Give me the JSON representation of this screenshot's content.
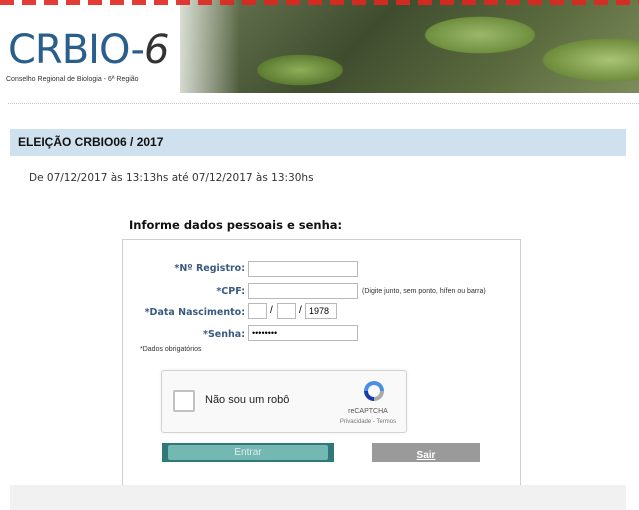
{
  "header": {
    "logo_main": "CRBIO-",
    "logo_number": "6",
    "logo_subtitle": "Conselho Regional de Biologia - 6ª Região"
  },
  "page": {
    "title": "ELEIÇÃO CRBIO06 / 2017",
    "period": "De 07/12/2017 às 13:13hs  até  07/12/2017 às 13:30hs"
  },
  "form": {
    "heading": "Informe dados pessoais e senha:",
    "registro_label": "*Nº Registro:",
    "registro_value": "",
    "cpf_label": "*CPF:",
    "cpf_value": "",
    "cpf_hint": "(Digite junto, sem ponto, hífen ou barra)",
    "nascimento_label": "*Data Nascimento:",
    "dia_value": "",
    "mes_value": "",
    "ano_value": "1978",
    "date_separator": "/",
    "senha_label": "*Senha:",
    "senha_value": "••••••••",
    "required_note": "*Dados obrigatórios"
  },
  "captcha": {
    "label": "Não sou um robô",
    "brand": "reCAPTCHA",
    "links": "Privacidade - Termos"
  },
  "buttons": {
    "entrar": "Entrar",
    "sair": "Sair"
  },
  "colors": {
    "title_bar": "#cfe0ef",
    "label_blue": "#3a5a80",
    "entrar_button": "#2f7a78",
    "sair_button": "#9a9a9a"
  }
}
